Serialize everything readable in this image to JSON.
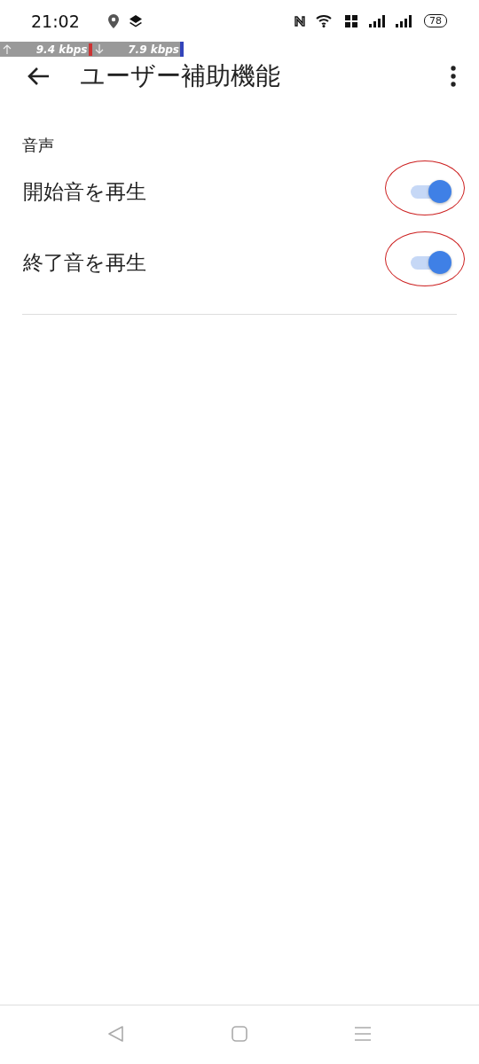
{
  "status_bar": {
    "time": "21:02",
    "battery": "78"
  },
  "speed_bar": {
    "upload": "9.4 kbps",
    "download": "7.9 kbps"
  },
  "toolbar": {
    "title": "ユーザー補助機能"
  },
  "section": {
    "header": "音声"
  },
  "settings": [
    {
      "label": "開始音を再生",
      "on": true,
      "circled": true
    },
    {
      "label": "終了音を再生",
      "on": true,
      "circled": true
    }
  ]
}
